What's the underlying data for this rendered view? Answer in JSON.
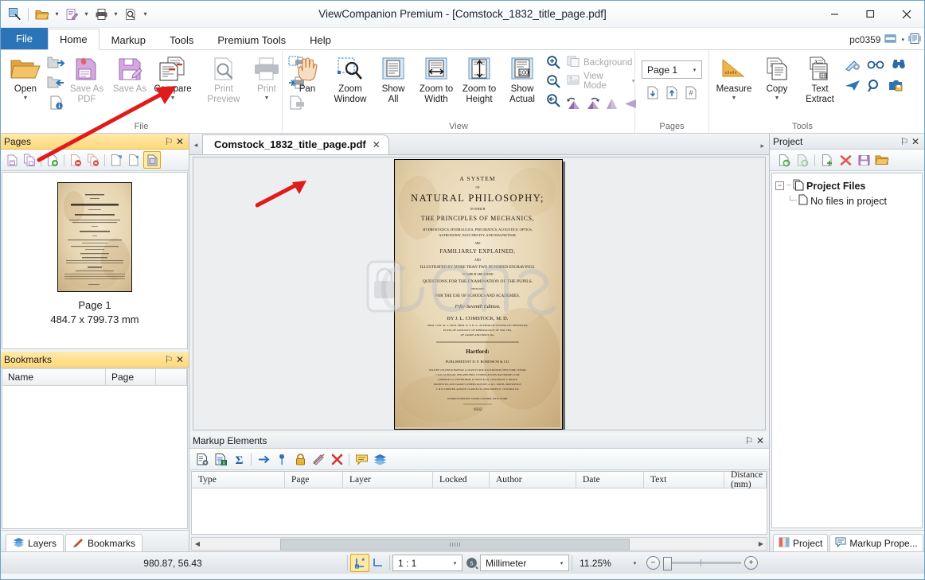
{
  "window": {
    "title": "ViewCompanion Premium - [Comstock_1832_title_page.pdf]",
    "minimize": "─",
    "maximize": "☐",
    "close": "✕",
    "user": "pc0359"
  },
  "quick_access": {
    "items": [
      "zoom-find-icon",
      "open-folder-icon",
      "markup-edit-icon",
      "print-icon",
      "print-preview-icon"
    ],
    "caret": "▾"
  },
  "ribbon_tabs": [
    {
      "label": "File",
      "active": false,
      "style": "file"
    },
    {
      "label": "Home",
      "active": true
    },
    {
      "label": "Markup",
      "active": false
    },
    {
      "label": "Tools",
      "active": false
    },
    {
      "label": "Premium Tools",
      "active": false
    },
    {
      "label": "Help",
      "active": false
    }
  ],
  "ribbon": {
    "groups": [
      {
        "title": "File",
        "buttons": [
          {
            "label": "Open",
            "dropdown": true,
            "disabled": false,
            "icon": "open-folder-icon"
          },
          {
            "label": "Save As PDF",
            "dropdown": false,
            "disabled": true,
            "icon": "save-as-pdf-icon"
          },
          {
            "label": "Save As",
            "dropdown": false,
            "disabled": true,
            "icon": "save-as-icon"
          },
          {
            "label": "Compare",
            "dropdown": true,
            "disabled": false,
            "icon": "compare-icon"
          },
          {
            "label": "Print Preview",
            "dropdown": false,
            "disabled": true,
            "icon": "print-preview-icon"
          },
          {
            "label": "Print",
            "dropdown": true,
            "disabled": true,
            "icon": "printer-icon"
          }
        ],
        "side_icons": [
          "print-region-icon",
          "print-fast-icon",
          "print-file-icon"
        ]
      },
      {
        "title": "View",
        "buttons": [
          {
            "label": "Pan",
            "icon": "hand-pan-icon"
          },
          {
            "label": "Zoom Window",
            "icon": "zoom-window-icon"
          },
          {
            "label": "Show All",
            "icon": "show-all-icon"
          },
          {
            "label": "Zoom to Width",
            "icon": "zoom-width-icon"
          },
          {
            "label": "Zoom to Height",
            "icon": "zoom-height-icon"
          },
          {
            "label": "Show Actual",
            "icon": "show-actual-icon"
          }
        ],
        "zoom_icons": [
          "zoom-in-icon",
          "zoom-out-icon",
          "zoom-previous-icon"
        ],
        "rotate_icons": [
          "rotate-left-icon",
          "rotate-right-icon",
          "flip-vertical-icon",
          "flip-horizontal-icon"
        ],
        "toggles": [
          {
            "label": "Background",
            "disabled": true,
            "icon": "background-icon"
          },
          {
            "label": "View Mode",
            "disabled": true,
            "dropdown": true,
            "icon": "view-mode-icon"
          }
        ]
      },
      {
        "title": "Pages",
        "page_select": {
          "value": "Page 1",
          "arrow": "▾"
        },
        "icons": [
          "page-insert-below-icon",
          "page-insert-above-icon",
          "page-number-icon"
        ]
      },
      {
        "title": "Tools",
        "buttons": [
          {
            "label": "Measure",
            "dropdown": true,
            "icon": "measure-ruler-icon"
          },
          {
            "label": "Copy",
            "dropdown": true,
            "icon": "copy-icon"
          },
          {
            "label": "Text Extract",
            "dropdown": false,
            "icon": "text-extract-icon"
          }
        ],
        "side_icons": [
          "pen-settings-icon",
          "glasses-icon",
          "binoculars-icon",
          "send-icon",
          "search-icon",
          "snapshot-save-icon"
        ]
      }
    ]
  },
  "pages_panel": {
    "title": "Pages",
    "pin": "⚐",
    "close": "✕",
    "toolbar_icons": [
      "save-page-icon",
      "save-pages-icon",
      "add-page-icon",
      "delete-page-icon",
      "delete-pages-icon",
      "extract-page-icon",
      "move-page-icon",
      "thumbnail-view-icon"
    ],
    "thumbnail": {
      "label": "Page 1",
      "dimensions": "484.7 x 799.73 mm"
    }
  },
  "bookmarks_panel": {
    "title": "Bookmarks",
    "pin": "⚐",
    "close": "✕",
    "columns": [
      "Name",
      "Page"
    ],
    "rows": []
  },
  "left_bottom_tabs": [
    {
      "label": "Layers",
      "icon": "layers-icon"
    },
    {
      "label": "Bookmarks",
      "icon": "bookmark-ribbon-icon"
    }
  ],
  "document_tab": {
    "label": "Comstock_1832_title_page.pdf",
    "close": "✕",
    "left_arrow": "◂",
    "right_arrow": "▸"
  },
  "document_page": {
    "lines": [
      "A SYSTEM",
      "OF",
      "NATURAL PHILOSOPHY;",
      "IN WHICH",
      "THE PRINCIPLES OF MECHANICS,",
      "HYDROSTATICS, HYDRAULICS, PNEUMATICS, ACOUSTICS, OPTICS,",
      "ASTRONOMY, ELECTRICITY, AND MAGNETISM,",
      "ARE",
      "FAMILIARLY EXPLAINED,",
      "AND",
      "ILLUSTRATED BY MORE THAN TWO HUNDRED ENGRAVINGS.",
      "TO WHICH ARE ADDED",
      "QUESTIONS FOR THE EXAMINATION OF THE PUPILS.",
      "DESIGNED",
      "FOR THE USE OF SCHOOLS AND ACADEMIES.",
      "Fifty-Seventh Edition.",
      "BY J. L. COMSTOCK, M. D.",
      "MEM. CON. M. S.; HON. MEM. N. Y. H. S.; AUTHOR OF SYSTEM OF CHEMISTRY;",
      "ELEM. OF GEOLOGY; OF MINERALOGY; OF NAT. HIS.",
      "OF GRAPE AND FRUIT, &c.",
      "Hartford:",
      "PUBLISHED BY D. F. ROBINSON & CO.",
      "SOLD BY COLLINS & HANNAY, A. LEAVITT, ROE & LOCKWOOD, NEW-YORK; TOWAR,",
      "J. & D. M. HOGAN, PHILADELPHIA; CUSHING & SONS, BALTIMORE; LUKE",
      "LOOMIS & CO., PITTSBURGH; H. HOWE & CO., CINCINNATI; S. DRAKE,",
      "ROCHESTER; AND VARIOUS OTHERS, BOSTON; A. & C. SMITH, PROVIDENCE;",
      "J. & W. FORSTER, ALBANY; CLAPP & CO., NEW-HAVEN; E. CUTLER & CO.",
      "STEREOTYPED BY JAMES CONNER, NEW-YORK.",
      "1832"
    ]
  },
  "markup_panel": {
    "title": "Markup Elements",
    "pin": "⚐",
    "close": "✕",
    "toolbar_icons": [
      "markup-properties-icon",
      "export-excel-icon",
      "sum-icon",
      "goto-icon",
      "tool-settings-icon",
      "lock-icon",
      "hide-icon",
      "delete-icon",
      "comment-icon",
      "layers-icon"
    ],
    "columns": [
      "Type",
      "Page",
      "Layer",
      "Locked",
      "Author",
      "Date",
      "Text",
      "Distance (mm)"
    ],
    "rows": []
  },
  "project_panel": {
    "title": "Project",
    "pin": "⚐",
    "close": "✕",
    "toolbar_icons": [
      "open-project-icon",
      "reload-project-icon",
      "add-file-icon",
      "remove-file-icon",
      "save-project-icon",
      "browse-folder-icon"
    ],
    "tree": {
      "root": "Project Files",
      "expander": "−",
      "child": "No files in project"
    }
  },
  "right_bottom_tabs": [
    {
      "label": "Project",
      "icon": "project-icon"
    },
    {
      "label": "Markup Prope...",
      "icon": "markup-properties-icon"
    }
  ],
  "status_bar": {
    "coordinates": "980.87, 56.43",
    "snap_icon": "snap-icon",
    "ortho_icon": "ortho-icon",
    "scale": {
      "value": "1 : 1",
      "arrow": "▾"
    },
    "unit_icon": "unit-icon",
    "unit": {
      "value": "Millimeter",
      "arrow": "▾"
    },
    "zoom": {
      "value": "11.25%",
      "arrow": "▾"
    },
    "zoom_out": "−",
    "zoom_in": "+"
  },
  "colors": {
    "accent": "#2b74b8",
    "panel_header": "#ffd97a",
    "highlight": "#ffe9a8",
    "arrow_annotation": "#e01b1b"
  }
}
